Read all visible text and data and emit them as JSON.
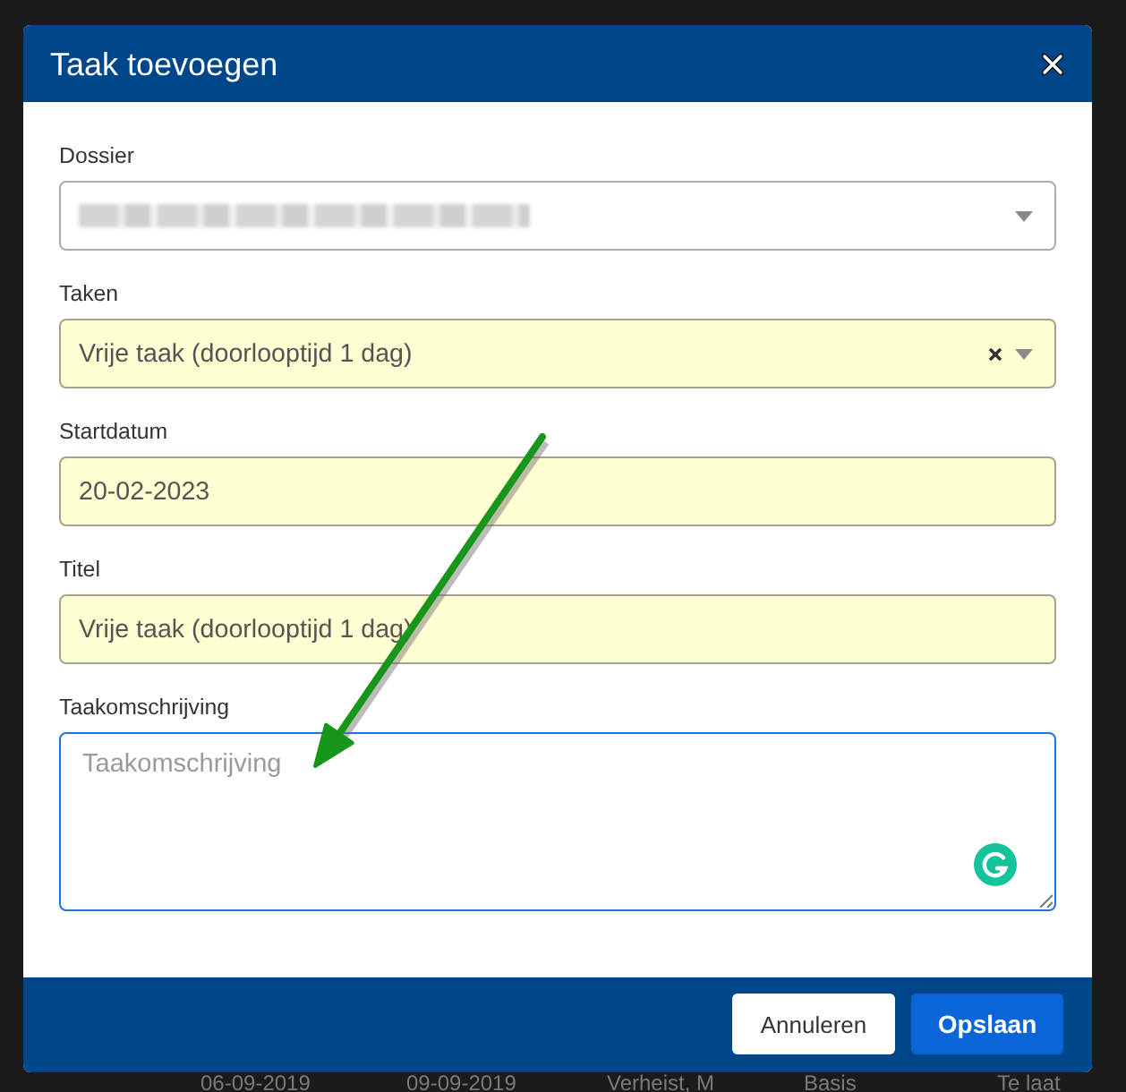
{
  "dialog": {
    "title": "Taak toevoegen",
    "fields": [
      {
        "kind": "select",
        "label": "Dossier",
        "redacted": true,
        "highlighted": false,
        "focused": false,
        "clearable": false
      },
      {
        "kind": "select",
        "label": "Taken",
        "value": "Vrije taak (doorlooptijd 1 dag)",
        "highlighted": true,
        "focused": false,
        "clearable": true
      },
      {
        "kind": "text",
        "label": "Startdatum",
        "value": "20-02-2023",
        "highlighted": true,
        "focused": false
      },
      {
        "kind": "text",
        "label": "Titel",
        "value": "Vrije taak (doorlooptijd 1 dag)",
        "highlighted": true,
        "focused": false
      },
      {
        "kind": "textarea",
        "label": "Taakomschrijving",
        "placeholder": "Taakomschrijving",
        "highlighted": false,
        "focused": true
      }
    ],
    "buttons": [
      {
        "label": "Annuleren",
        "kind": "secondary"
      },
      {
        "label": "Opslaan",
        "kind": "primary"
      }
    ]
  },
  "background_table": {
    "row": [
      "06-09-2019",
      "09-09-2019",
      "Verheist, M",
      "Basis",
      "Te laat"
    ]
  }
}
